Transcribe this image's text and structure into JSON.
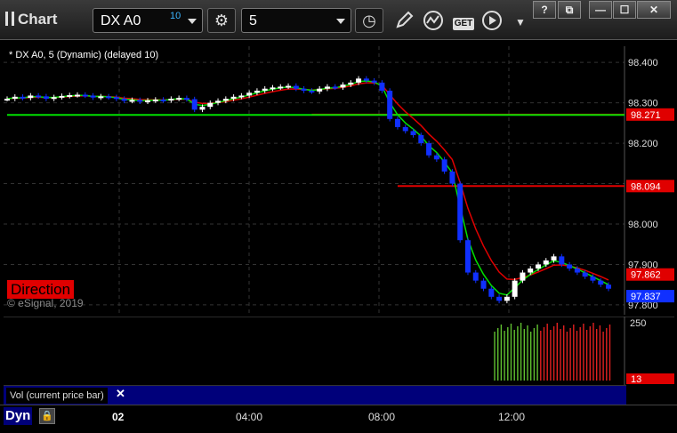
{
  "window": {
    "title": "Chart",
    "buttons": [
      "?",
      "⧉",
      "—",
      "☐",
      "✕"
    ]
  },
  "toolbar": {
    "symbol": "DX A0",
    "delay": "10",
    "interval": "5",
    "get_label": "GET"
  },
  "chart": {
    "study_title": "* DX A0, 5 (Dynamic) (delayed 10)",
    "direction_label": "Direction",
    "copyright": "© eSignal, 2019",
    "price_ticks": [
      "98.400",
      "98.300",
      "98.200",
      "98.100",
      "98.000",
      "97.900",
      "97.800"
    ],
    "price_flags": [
      {
        "value": "98.271",
        "color": "#e00000"
      },
      {
        "value": "98.094",
        "color": "#e00000"
      },
      {
        "value": "97.862",
        "color": "#e00000"
      },
      {
        "value": "97.837",
        "color": "#1030ff"
      }
    ],
    "colors": {
      "up": "#ffffff",
      "down": "#1030ff",
      "ma_fast": "#00e000",
      "ma_slow": "#e00000",
      "grid": "#333333"
    }
  },
  "volume": {
    "label": "Vol (current price bar)",
    "ticks": [
      "250"
    ],
    "flag": "13"
  },
  "time_axis": {
    "labels": [
      "02",
      "04:00",
      "08:00",
      "12:00"
    ],
    "dyn_label": "Dyn"
  },
  "chart_data": {
    "type": "candlestick",
    "title": "DX A0, 5 (Dynamic) (delayed 10)",
    "ylim": [
      97.78,
      98.44
    ],
    "horizontal_lines": [
      {
        "value": 98.271,
        "color": "red",
        "start": 39
      },
      {
        "value": 98.094,
        "color": "red",
        "start": 50
      },
      {
        "value": 98.27,
        "color": "green",
        "start": 0
      }
    ],
    "close": [
      98.31,
      98.315,
      98.312,
      98.318,
      98.316,
      98.31,
      98.314,
      98.317,
      98.319,
      98.32,
      98.318,
      98.313,
      98.316,
      98.314,
      98.31,
      98.305,
      98.307,
      98.303,
      98.306,
      98.308,
      98.306,
      98.31,
      98.312,
      98.309,
      98.283,
      98.29,
      98.3,
      98.305,
      98.31,
      98.315,
      98.318,
      98.325,
      98.33,
      98.335,
      98.338,
      98.34,
      98.342,
      98.335,
      98.33,
      98.328,
      98.335,
      98.34,
      98.338,
      98.345,
      98.35,
      98.36,
      98.355,
      98.35,
      98.33,
      98.26,
      98.24,
      98.23,
      98.22,
      98.2,
      98.17,
      98.16,
      98.13,
      98.1,
      97.96,
      97.88,
      97.86,
      97.84,
      97.82,
      97.81,
      97.82,
      97.86,
      97.88,
      97.89,
      97.9,
      97.91,
      97.92,
      97.9,
      97.89,
      97.88,
      97.87,
      97.86,
      97.85,
      97.84
    ]
  }
}
